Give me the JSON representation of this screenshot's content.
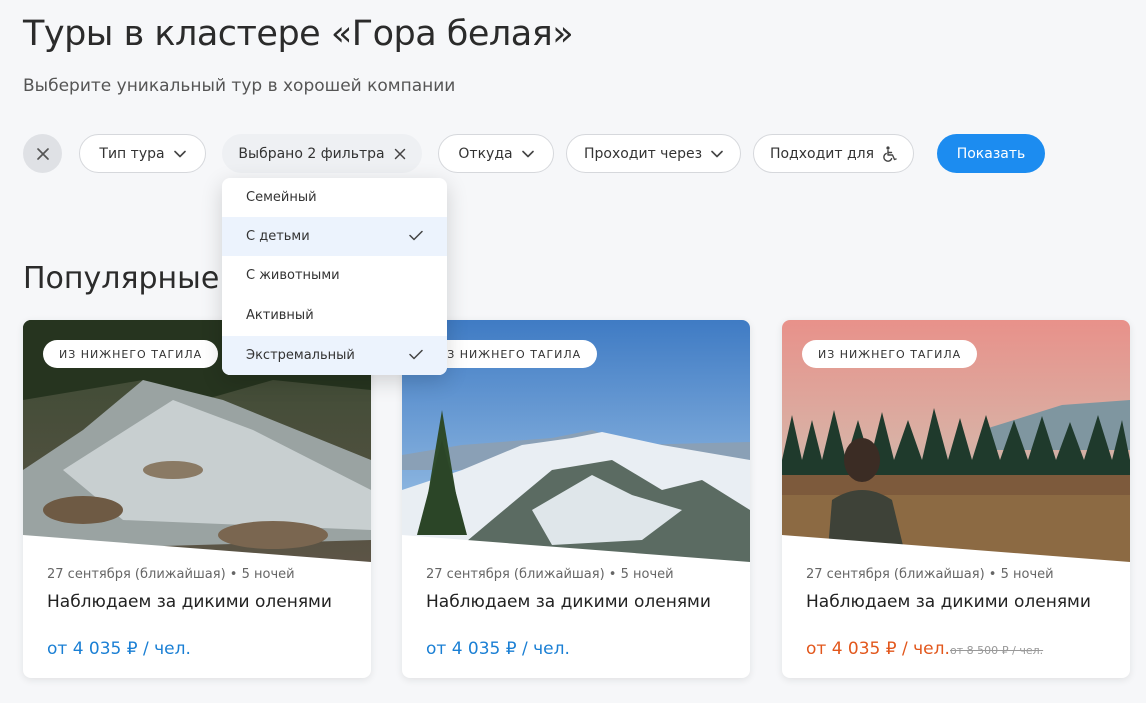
{
  "header": {
    "title": "Туры в кластере «Гора белая»",
    "subtitle": "Выберите уникальный тур в хорошей компании"
  },
  "filters": {
    "tour_type": "Тип тура",
    "selected": "Выбрано 2 фильтра",
    "from": "Откуда",
    "passes_through": "Проходит через",
    "suits_for": "Подходит для",
    "show_button": "Показать"
  },
  "dropdown": {
    "items": [
      {
        "label": "Семейный",
        "selected": false
      },
      {
        "label": "С детьми",
        "selected": true
      },
      {
        "label": "С животными",
        "selected": false
      },
      {
        "label": "Активный",
        "selected": false
      },
      {
        "label": "Экстремальный",
        "selected": true
      }
    ]
  },
  "section": {
    "title": "Популярные туры"
  },
  "cards": [
    {
      "badge": "ИЗ НИЖНЕГО ТАГИЛА",
      "meta": "27 сентября (ближайшая) • 5 ночей",
      "title": "Наблюдаем за дикими оленями",
      "price": "от 4 035 ₽ / чел.",
      "old_price": ""
    },
    {
      "badge": "ИЗ НИЖНЕГО ТАГИЛА",
      "meta": "27 сентября (ближайшая) • 5 ночей",
      "title": "Наблюдаем за дикими оленями",
      "price": "от 4 035 ₽ / чел.",
      "old_price": ""
    },
    {
      "badge": "ИЗ НИЖНЕГО ТАГИЛА",
      "meta": "27 сентября (ближайшая) • 5 ночей",
      "title": "Наблюдаем за дикими оленями",
      "price": "от 4 035 ₽ / чел.",
      "old_price": "от 8 500 ₽ / чел."
    }
  ],
  "colors": {
    "accent": "#1c8cf0",
    "price": "#1a7fd4",
    "discount_price": "#e2571c"
  },
  "icons": [
    "close-icon",
    "chevron-down-icon",
    "wheelchair-icon",
    "check-icon"
  ]
}
